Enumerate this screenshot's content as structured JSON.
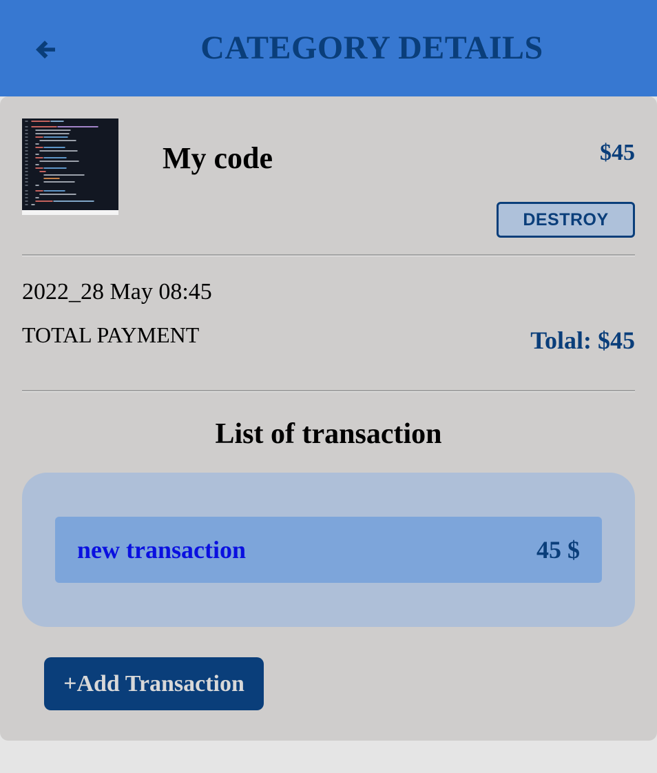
{
  "header": {
    "title": "CATEGORY DETAILS",
    "back_icon": "arrow-left-icon"
  },
  "category": {
    "name": "My code",
    "amount": "$45",
    "thumbnail": "code-screenshot-thumbnail",
    "destroy_label": "DESTROY",
    "date": "2022_28 May 08:45",
    "total_label": "TOTAL PAYMENT",
    "total_value": "Tolal: $45"
  },
  "transactions": {
    "heading": "List of transaction",
    "items": [
      {
        "name": "new transaction",
        "amount": "45 $"
      }
    ],
    "add_label": "+Add Transaction"
  },
  "colors": {
    "header_bg": "#3778d1",
    "accent": "#0a3e7a",
    "card_bg": "#cfcdcc",
    "list_panel_bg": "#aebfd8",
    "row_bg": "#7da5da",
    "link": "#0a10e0"
  }
}
